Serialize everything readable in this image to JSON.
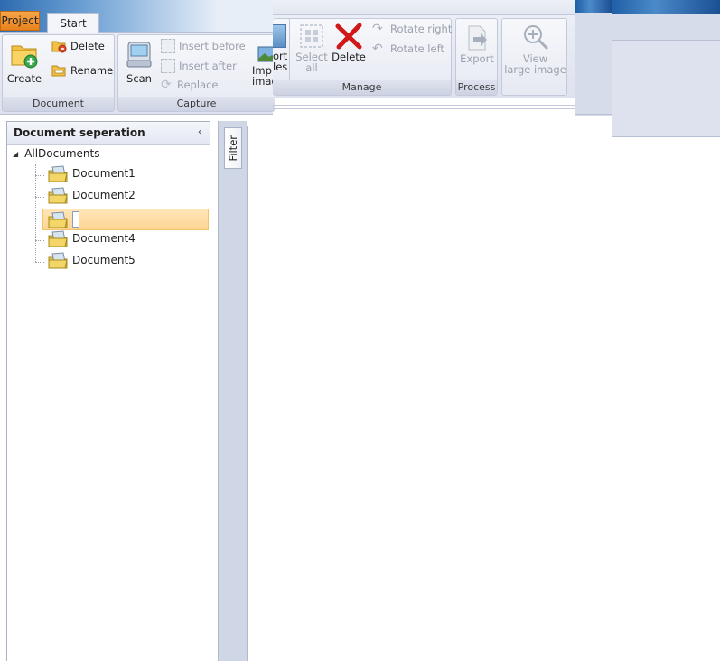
{
  "ribbon": {
    "tabs": {
      "project": "Project",
      "start": "Start"
    },
    "document_group": {
      "label": "Document",
      "create": "Create",
      "delete": "Delete",
      "rename": "Rename"
    },
    "capture_group": {
      "label": "Capture",
      "scan": "Scan",
      "insert_before": "Insert before",
      "insert_after": "Insert after",
      "replace": "Replace",
      "import_line1": "Imp",
      "import_line2": "imag"
    },
    "manage_group": {
      "label": "Manage",
      "import_partial_line1": "ort",
      "import_partial_line2": "les",
      "select_all_line1": "Select",
      "select_all_line2": "all",
      "delete": "Delete",
      "rotate_right": "Rotate right",
      "rotate_left": "Rotate left"
    },
    "process_group": {
      "label": "Process",
      "export": "Export"
    },
    "view_group": {
      "view_line1": "View",
      "view_line2": "large image"
    }
  },
  "panel": {
    "title": "Document seperation",
    "collapse_glyph": "‹",
    "root": "AllDocuments",
    "items": [
      {
        "label": "Document1"
      },
      {
        "label": "Document2"
      },
      {
        "label": ""
      },
      {
        "label": "Document4"
      },
      {
        "label": "Document5"
      }
    ]
  },
  "filter": {
    "label": "Filter"
  },
  "colors": {
    "project_tab": "#e9821c",
    "selection": "#ffd494",
    "delete_red": "#d01818"
  }
}
